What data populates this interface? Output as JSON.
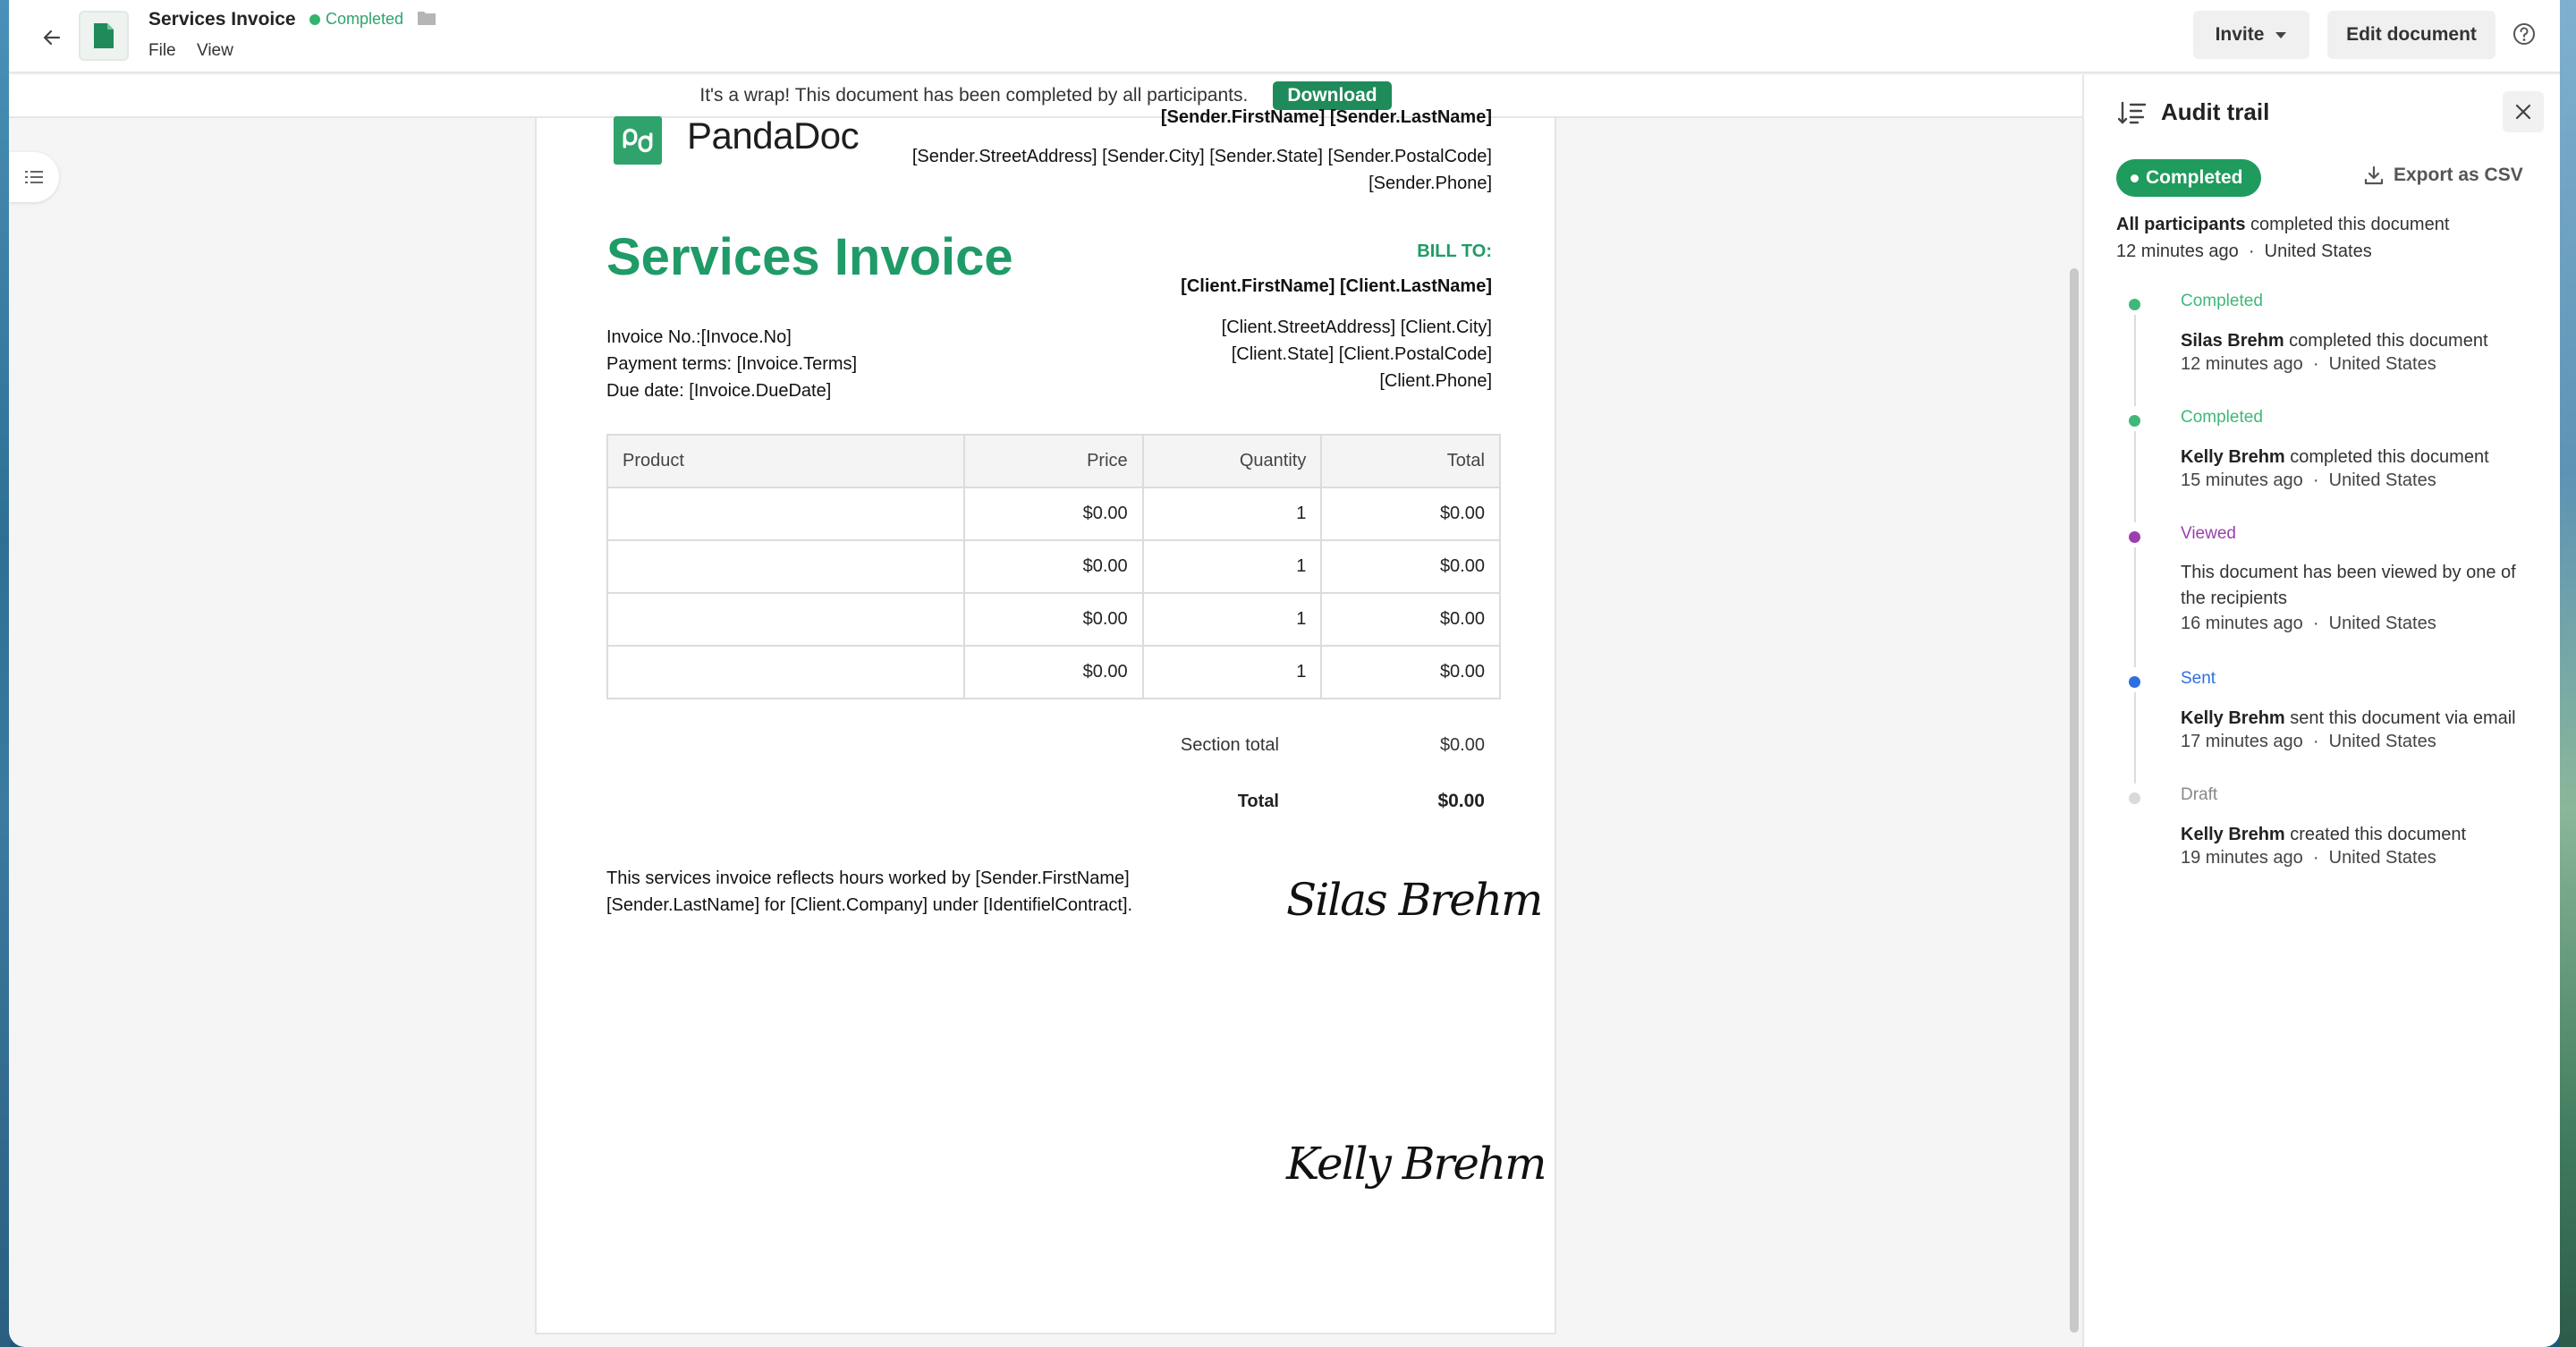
{
  "header": {
    "doc_title": "Services Invoice",
    "status": "Completed",
    "menu": [
      "File",
      "View"
    ],
    "invite_label": "Invite",
    "edit_label": "Edit document"
  },
  "banner": {
    "text": "It's a wrap! This document has been completed by all participants.",
    "download_label": "Download"
  },
  "document": {
    "logo_text": "PandaDoc",
    "sender_name_line": "[Sender.FirstName] [Sender.LastName]",
    "sender_address_line1": "[Sender.StreetAddress] [Sender.City] [Sender.State] [Sender.PostalCode]",
    "sender_phone": "[Sender.Phone]",
    "title": "Services Invoice",
    "bill_to_label": "BILL TO:",
    "client_name": "[Client.FirstName] [Client.LastName]",
    "client_address_line1": "[Client.StreetAddress] [Client.City]",
    "client_address_line2": "[Client.State] [Client.PostalCode]",
    "client_phone": "[Client.Phone]",
    "invoice_no": "Invoice No.:[Invoce.No]",
    "payment_terms": "Payment terms: [Invoice.Terms]",
    "due_date": "Due date: [Invoice.DueDate]",
    "table": {
      "headers": [
        "Product",
        "Price",
        "Quantity",
        "Total"
      ],
      "rows": [
        [
          "",
          "$0.00",
          "1",
          "$0.00"
        ],
        [
          "",
          "$0.00",
          "1",
          "$0.00"
        ],
        [
          "",
          "$0.00",
          "1",
          "$0.00"
        ],
        [
          "",
          "$0.00",
          "1",
          "$0.00"
        ]
      ]
    },
    "section_total_label": "Section total",
    "section_total_value": "$0.00",
    "total_label": "Total",
    "total_value": "$0.00",
    "note": "This services invoice reflects hours worked by [Sender.FirstName] [Sender.LastName] for [Client.Company] under [IdentifielContract].",
    "signature_1": "Silas Brehm",
    "signature_2": "Kelly Brehm"
  },
  "audit": {
    "title": "Audit trail",
    "status_pill": "Completed",
    "export_label": "Export as CSV",
    "summary_bold": "All participants",
    "summary_rest": " completed this document",
    "summary_time": "12 minutes ago",
    "summary_location": "United States",
    "events": [
      {
        "status": "Completed",
        "actor": "Silas Brehm",
        "action": " completed this document",
        "time": "12 minutes ago",
        "location": "United States",
        "color": "#3fb879",
        "text_color": "#3fb879"
      },
      {
        "status": "Completed",
        "actor": "Kelly Brehm",
        "action": " completed this document",
        "time": "15 minutes ago",
        "location": "United States",
        "color": "#3fb879",
        "text_color": "#3fb879"
      },
      {
        "status": "Viewed",
        "actor": "",
        "action": "This document has been viewed by one of the recipients",
        "time": "16 minutes ago",
        "location": "United States",
        "color": "#9b3fb0",
        "text_color": "#9b3fb0"
      },
      {
        "status": "Sent",
        "actor": "Kelly Brehm",
        "action": " sent this document via email",
        "time": "17 minutes ago",
        "location": "United States",
        "color": "#2e6fe0",
        "text_color": "#2e6fe0"
      },
      {
        "status": "Draft",
        "actor": "Kelly Brehm",
        "action": " created this document",
        "time": "19 minutes ago",
        "location": "United States",
        "color": "#d9d9d9",
        "text_color": "#888888"
      }
    ]
  },
  "colors": {
    "accent_green": "#1f9b67",
    "download_green": "#1f8a5a"
  }
}
